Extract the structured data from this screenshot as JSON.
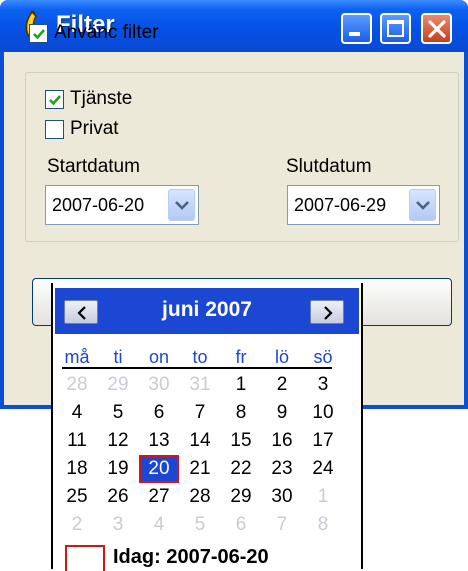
{
  "window": {
    "title": "Filter"
  },
  "filter": {
    "use_filter_label": "Använc filter",
    "use_filter_checked": true,
    "service_label": "Tjänste",
    "service_checked": true,
    "private_label": "Privat",
    "private_checked": false
  },
  "dates": {
    "start_label": "Startdatum",
    "start_value": "2007-06-20",
    "end_label": "Slutdatum",
    "end_value": "2007-06-29"
  },
  "calendar": {
    "month_label": "juni 2007",
    "weekdays": [
      "må",
      "ti",
      "on",
      "to",
      "fr",
      "lö",
      "sö"
    ],
    "weeks": [
      [
        "28",
        "29",
        "30",
        "31",
        "1",
        "2",
        "3"
      ],
      [
        "4",
        "5",
        "6",
        "7",
        "8",
        "9",
        "10"
      ],
      [
        "11",
        "12",
        "13",
        "14",
        "15",
        "16",
        "17"
      ],
      [
        "18",
        "19",
        "20",
        "21",
        "22",
        "23",
        "24"
      ],
      [
        "25",
        "26",
        "27",
        "28",
        "29",
        "30",
        "1"
      ],
      [
        "2",
        "3",
        "4",
        "5",
        "6",
        "7",
        "8"
      ]
    ],
    "other_month_cells": [
      "0-0",
      "0-1",
      "0-2",
      "0-3",
      "4-6",
      "5-0",
      "5-1",
      "5-2",
      "5-3",
      "5-4",
      "5-5",
      "5-6"
    ],
    "selected_cell": "3-2",
    "today_label": "Idag: 2007-06-20"
  },
  "colors": {
    "titlebar": "#0551e6",
    "calendar_header": "#1b47d3",
    "weekday_text": "#1b47d3",
    "today_border": "#d01818",
    "other_month_text": "#c9ccd3"
  },
  "icons": {
    "app": "banana-icon",
    "minimize": "minimize-icon",
    "maximize": "maximize-icon",
    "close": "close-icon",
    "dropdown": "chevron-down-icon",
    "prev": "chevron-left-icon",
    "next": "chevron-right-icon",
    "check": "check-icon"
  }
}
